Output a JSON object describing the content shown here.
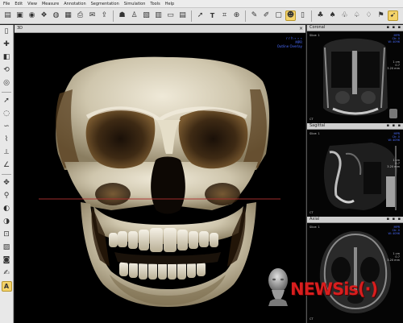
{
  "menubar": {
    "items": [
      "File",
      "Edit",
      "View",
      "Measure",
      "Annotation",
      "Segmentation",
      "Simulation",
      "Tools",
      "Help"
    ]
  },
  "toolbar": {
    "groups": [
      [
        "open-folder-icon",
        "save-icon",
        "camera-icon",
        "image-gallery-icon",
        "volume-render-icon",
        "view-layout-icon",
        "print-icon",
        "mail-icon",
        "export-icon"
      ],
      [
        "patient-icon",
        "user-icon",
        "image-icon",
        "film-icon",
        "monitor-icon",
        "report-icon"
      ],
      [
        "pointer-icon",
        "text-icon",
        "crop-icon",
        "zoom-icon"
      ],
      [
        "note-icon",
        "edit-icon",
        "document-icon",
        "skull-view-icon",
        "ruler-icon"
      ],
      [
        "airway-icon",
        "tooth-icon",
        "implant-icon",
        "nerve-icon",
        "sinus-icon",
        "flag-icon",
        "cursor-help-icon"
      ]
    ],
    "selected": [
      "skull-view-icon",
      "cursor-help-icon"
    ]
  },
  "sidebar": {
    "tools": [
      "page-icon",
      "new-icon",
      "scan-icon",
      "rotate-icon",
      "reset-view-icon",
      "pointer-icon",
      "lasso-icon",
      "curve-icon",
      "sculpt-icon",
      "measure-icon",
      "angle-icon",
      "pan-icon",
      "zoom-icon",
      "window-level-icon",
      "contrast-icon",
      "crop-icon",
      "clip-icon",
      "camera-icon",
      "annotate-icon",
      "text-tool-icon"
    ],
    "selected": "text-tool-icon"
  },
  "view3d": {
    "tab_label": "3D",
    "close": "×",
    "overlay_right": [
      "r  r  h  ∙  ∙  ∙",
      "MPR",
      "Outline Overlay"
    ]
  },
  "panels": {
    "coronal": {
      "title": "Coronal",
      "buttons": "▪ ▪ ▪",
      "info_left": "Slice: 1",
      "info_right": [
        "MPR",
        "Ctr. 0",
        "W: 4096"
      ],
      "scale": [
        "1 cm",
        "0.7",
        "3.20 mm"
      ],
      "corner": "CT"
    },
    "sagittal": {
      "title": "Sagittal",
      "buttons": "▪ ▪ ▪",
      "info_left": "Slice: 1",
      "info_right": [
        "MPR",
        "Ctr. 0",
        "W: 4096"
      ],
      "scale": [
        "1 cm",
        "0.7",
        "3.20 mm"
      ],
      "corner": "CT"
    },
    "axial": {
      "title": "Axial",
      "buttons": "▪ ▪ ▪",
      "info_left": "Slice: 1",
      "info_right": [
        "MPR",
        "Ctr. 0",
        "W: 4096"
      ],
      "scale": [
        "1 cm",
        "0.7",
        "3.20 mm"
      ],
      "corner": "CT"
    }
  },
  "watermark": {
    "text": "NEWSis(·)"
  },
  "colors": {
    "selection": "#f4d36a",
    "overlay_text": "#4a6cff",
    "watermark": "#d81e1e",
    "reference_line": "#b03030"
  }
}
